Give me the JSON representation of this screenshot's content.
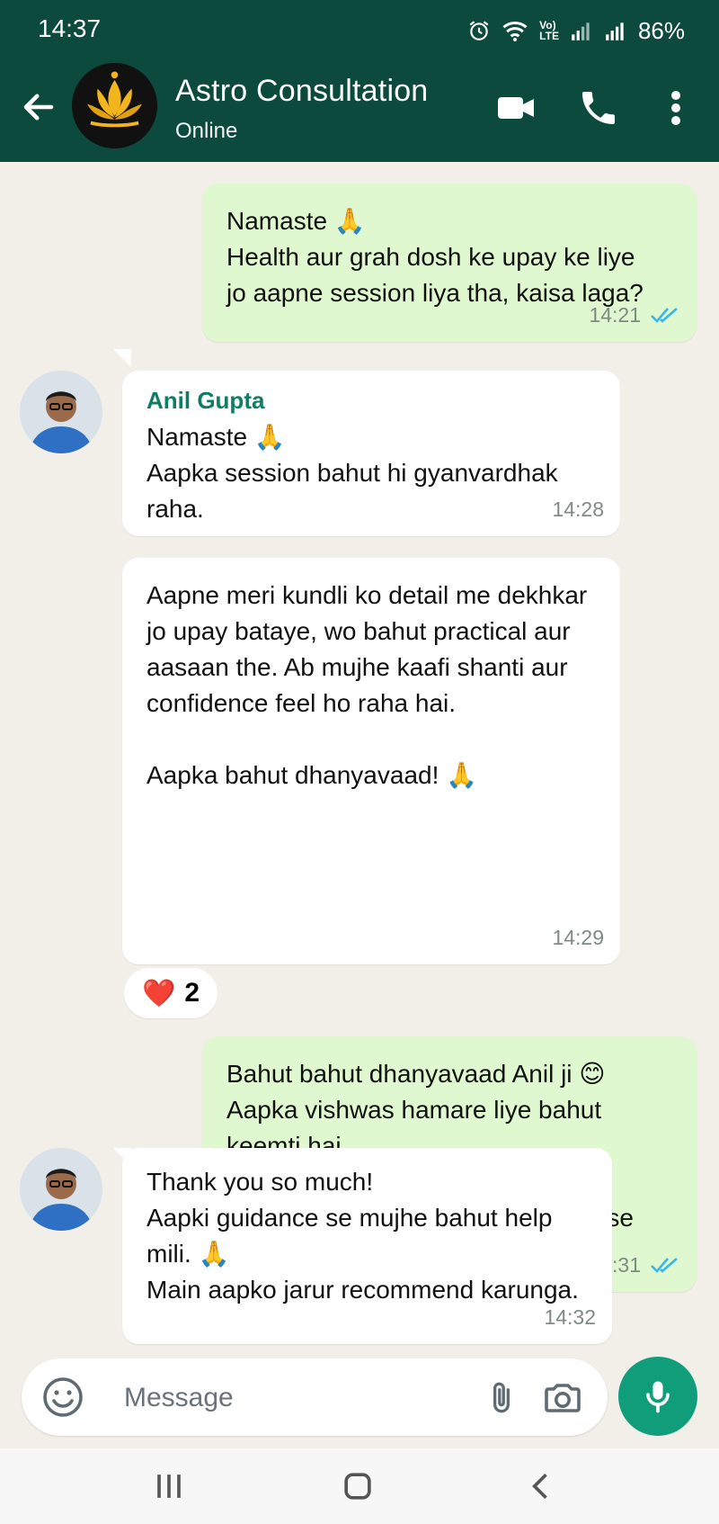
{
  "status_bar": {
    "time": "14:37",
    "network": "Vo)\nLTE",
    "battery": "86%"
  },
  "header": {
    "title": "Astro Consultation",
    "status": "Online"
  },
  "messages": [
    {
      "direction": "out",
      "text": "Namaste 🙏\nHealth aur grah dosh ke upay ke liye\njo aapne session liya tha, kaisa laga?",
      "time": "14:21",
      "read": true
    },
    {
      "direction": "in",
      "sender": "Anil Gupta",
      "text": "Namaste 🙏\nAapka session bahut hi gyanvardhak\nraha.",
      "time": "14:28"
    },
    {
      "direction": "in",
      "text": "Aapne meri kundli ko detail me dekhkar\njo upay bataye, wo bahut practical aur\naasaan the. Ab mujhe kaafi shanti aur\nconfidence feel ho raha hai.\n\nAapka bahut dhanyavaad! 🙏",
      "time": "14:29",
      "reaction": {
        "emoji": "❤️",
        "count": "2"
      }
    },
    {
      "direction": "out",
      "text": "Bahut bahut dhanyavaad Anil ji 😊\nAapka vishwas hamare liye bahut\nkeemti hai.\nGrahon ki kripa se aapka jeevan\nsadaiv sukh, shanti aur samriddhi se\nbhara rahe. 🙏✨",
      "time": "14:31",
      "read": true
    },
    {
      "direction": "in",
      "text": "Thank you so much!\nAapki guidance se mujhe bahut help\nmili. 🙏\nMain aapko jarur recommend karunga.",
      "time": "14:32"
    }
  ],
  "composer": {
    "placeholder": "Message"
  },
  "colors": {
    "header_bg": "#0b4a3d",
    "outgoing_bubble": "#dff8cf",
    "incoming_bubble": "#ffffff",
    "sender_name": "#0f7d66",
    "read_ticks": "#34b7f1",
    "mic_button": "#0f9d7a"
  },
  "icons": [
    "back-arrow-icon",
    "video-call-icon",
    "phone-icon",
    "more-vert-icon",
    "emoji-icon",
    "attach-icon",
    "camera-icon",
    "mic-icon",
    "alarm-icon",
    "wifi-icon",
    "signal-icon",
    "battery-icon",
    "recent-apps-icon",
    "home-icon",
    "nav-back-icon",
    "double-check-icon"
  ]
}
